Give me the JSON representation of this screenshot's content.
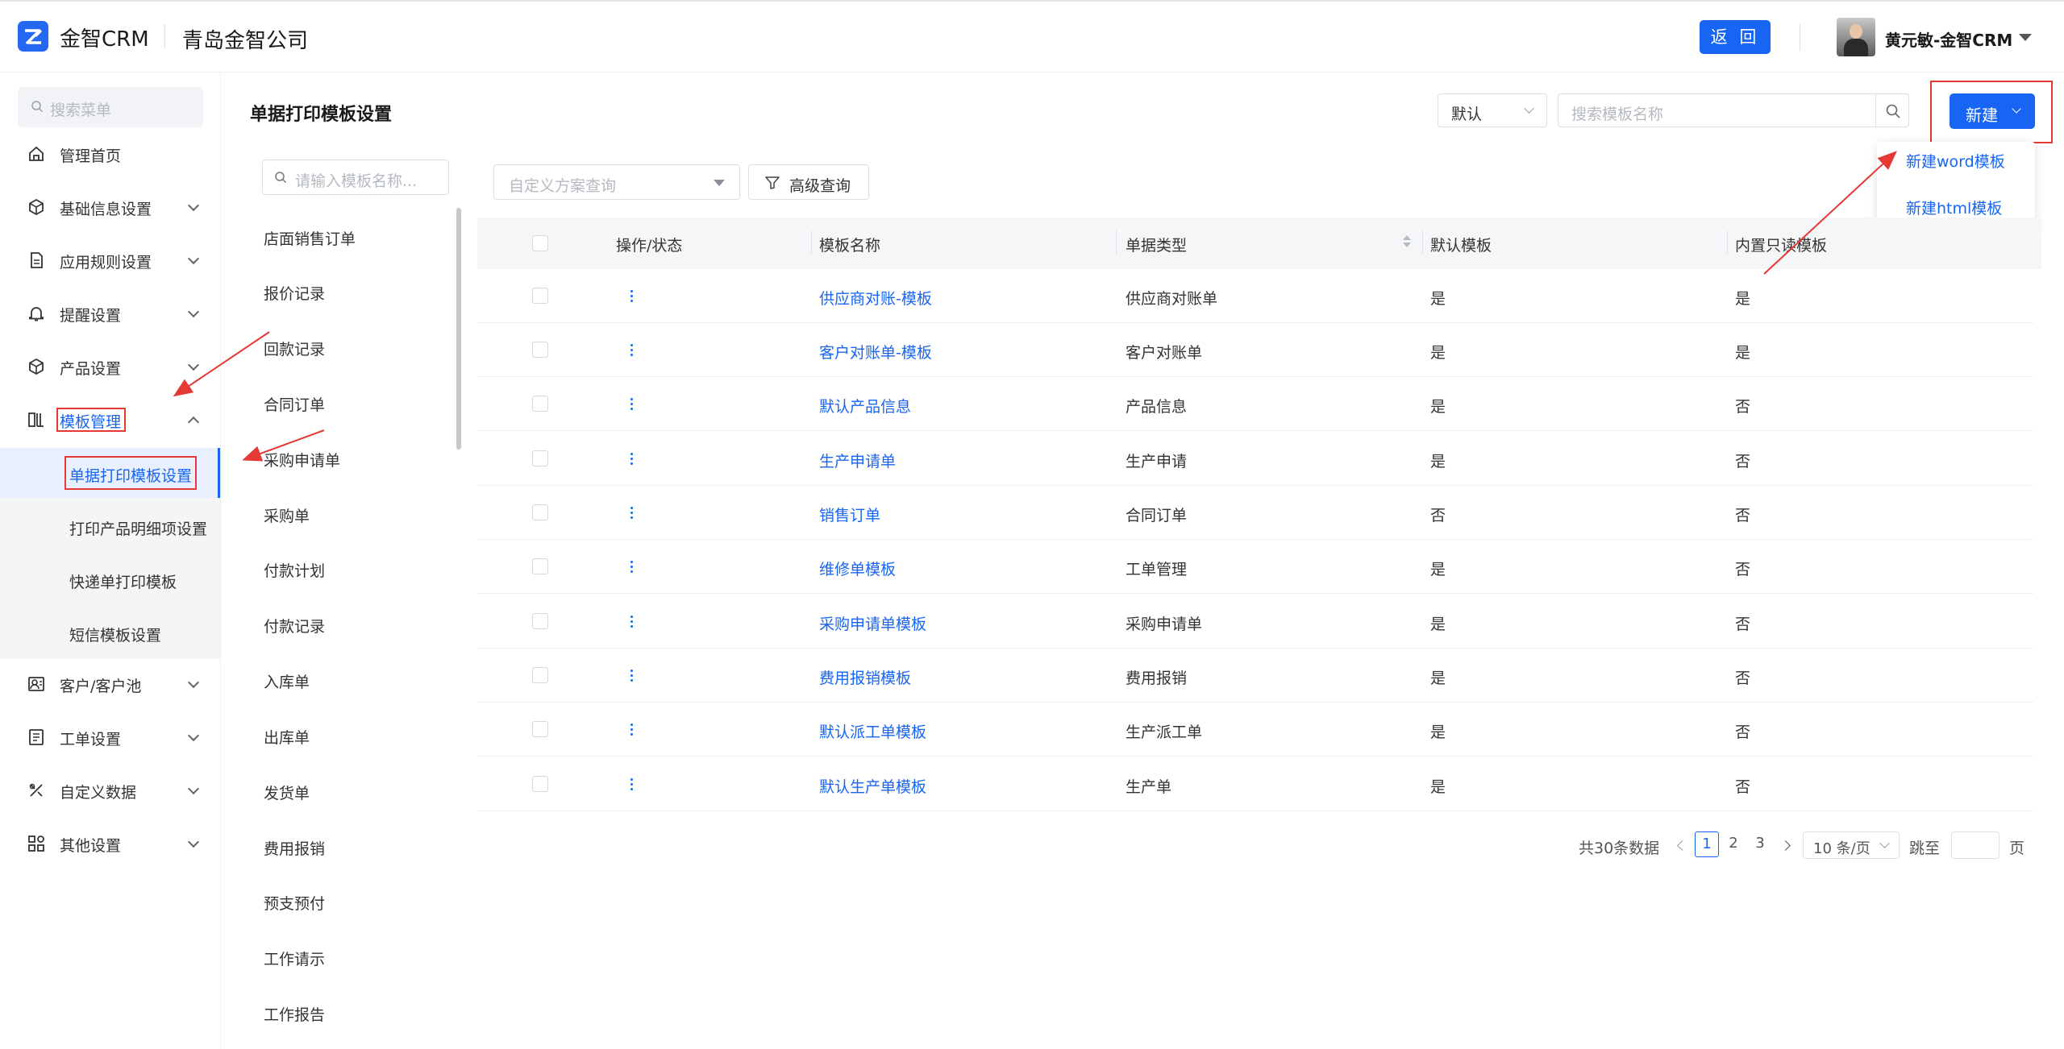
{
  "header": {
    "app_name": "金智CRM",
    "company": "青岛金智公司",
    "back_label": "返 回",
    "user_name": "黄元敏-金智CRM"
  },
  "sidebar": {
    "search_placeholder": "搜索菜单",
    "items": [
      {
        "label": "管理首页",
        "icon": "home-icon"
      },
      {
        "label": "基础信息设置",
        "icon": "cube-icon"
      },
      {
        "label": "应用规则设置",
        "icon": "document-icon"
      },
      {
        "label": "提醒设置",
        "icon": "bell-icon"
      },
      {
        "label": "产品设置",
        "icon": "box-icon"
      },
      {
        "label": "模板管理",
        "icon": "template-icon"
      },
      {
        "label": "客户/客户池",
        "icon": "customer-icon"
      },
      {
        "label": "工单设置",
        "icon": "ticket-icon"
      },
      {
        "label": "自定义数据",
        "icon": "tools-icon"
      },
      {
        "label": "其他设置",
        "icon": "grid-icon"
      }
    ],
    "sub_items": [
      "单据打印模板设置",
      "打印产品明细项设置",
      "快递单打印模板",
      "短信模板设置"
    ]
  },
  "main": {
    "title": "单据打印模板设置",
    "default_select": "默认",
    "search_placeholder": "搜索模板名称",
    "new_label": "新建",
    "dropdown": [
      "新建word模板",
      "新建html模板"
    ],
    "category_search_placeholder": "请输入模板名称...",
    "categories": [
      "店面销售订单",
      "报价记录",
      "回款记录",
      "合同订单",
      "采购申请单",
      "采购单",
      "付款计划",
      "付款记录",
      "入库单",
      "出库单",
      "发货单",
      "费用报销",
      "预支预付",
      "工作请示",
      "工作报告"
    ],
    "scheme_placeholder": "自定义方案查询",
    "advanced_label": "高级查询",
    "table": {
      "headers": [
        "操作/状态",
        "模板名称",
        "单据类型",
        "默认模板",
        "内置只读模板"
      ],
      "rows": [
        [
          "供应商对账-模板",
          "供应商对账单",
          "是",
          "是"
        ],
        [
          "客户对账单-模板",
          "客户对账单",
          "是",
          "是"
        ],
        [
          "默认产品信息",
          "产品信息",
          "是",
          "否"
        ],
        [
          "生产申请单",
          "生产申请",
          "是",
          "否"
        ],
        [
          "销售订单",
          "合同订单",
          "否",
          "否"
        ],
        [
          "维修单模板",
          "工单管理",
          "是",
          "否"
        ],
        [
          "采购申请单模板",
          "采购申请单",
          "是",
          "否"
        ],
        [
          "费用报销模板",
          "费用报销",
          "是",
          "否"
        ],
        [
          "默认派工单模板",
          "生产派工单",
          "是",
          "否"
        ],
        [
          "默认生产单模板",
          "生产单",
          "是",
          "否"
        ]
      ]
    },
    "pagination": {
      "total": "共30条数据",
      "pages": [
        "1",
        "2",
        "3"
      ],
      "current": "1",
      "page_size": "10 条/页",
      "jump_label": "跳至",
      "unit": "页"
    }
  },
  "colors": {
    "accent": "#1765f2",
    "annotation": "#e53935"
  }
}
